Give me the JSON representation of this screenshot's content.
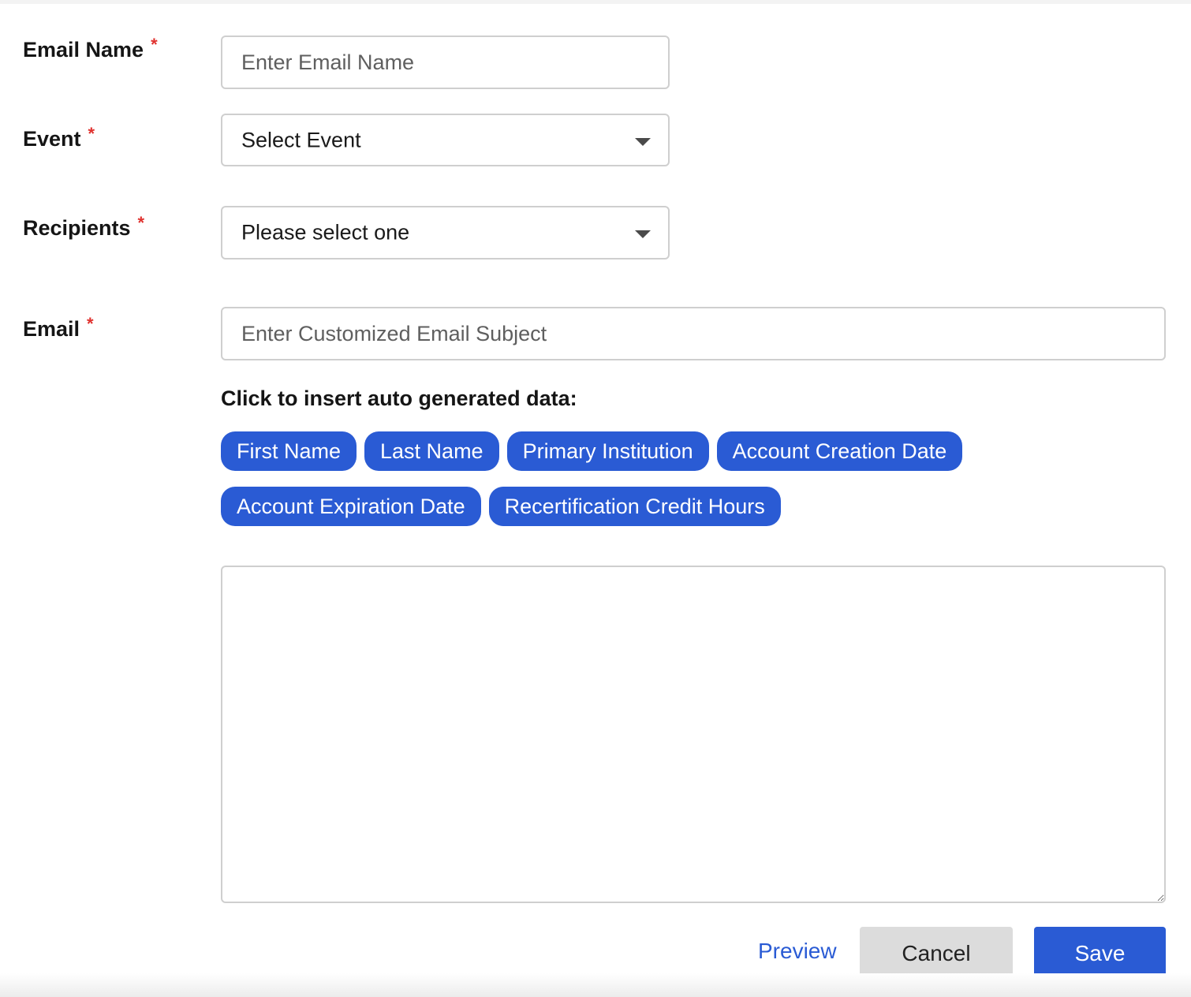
{
  "form": {
    "email_name": {
      "label": "Email Name",
      "required_mark": "*",
      "placeholder": "Enter Email Name",
      "value": ""
    },
    "event": {
      "label": "Event",
      "required_mark": "*",
      "selected": "Select Event"
    },
    "recipients": {
      "label": "Recipients",
      "required_mark": "*",
      "selected": "Please select one"
    },
    "email": {
      "label": "Email",
      "required_mark": "*",
      "subject_placeholder": "Enter Customized Email Subject",
      "subject_value": "",
      "insert_title": "Click to insert auto generated data:",
      "tokens": [
        "First Name",
        "Last Name",
        "Primary Institution",
        "Account Creation Date",
        "Account Expiration Date",
        "Recertification Credit Hours"
      ],
      "body_value": ""
    }
  },
  "actions": {
    "preview_label": "Preview",
    "cancel_label": "Cancel",
    "save_label": "Save"
  },
  "colors": {
    "accent": "#2a5bd4",
    "required": "#e0322f",
    "cancel_bg": "#dcdcdc",
    "border": "#cfcfcf"
  },
  "icons": {
    "dropdown": "chevron-down-icon",
    "resize": "resize-handle-icon"
  }
}
